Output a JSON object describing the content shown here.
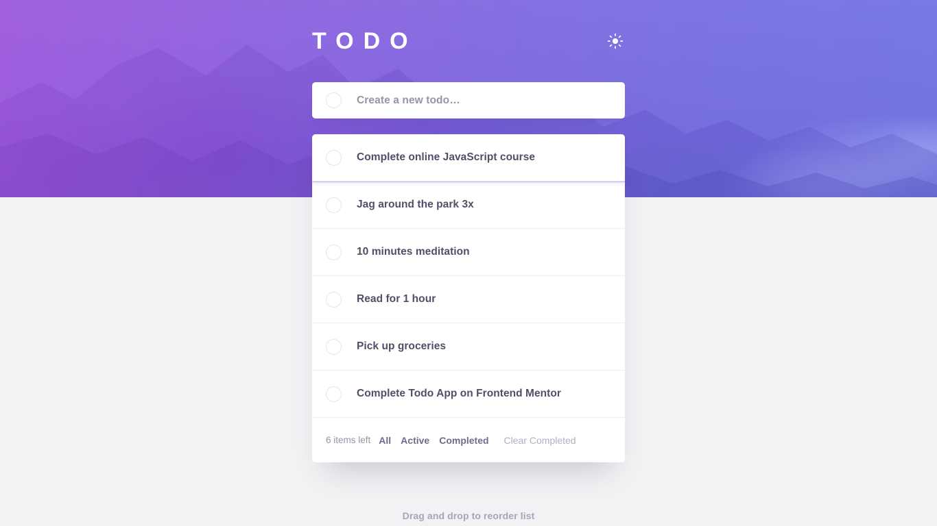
{
  "app": {
    "title": "TODO",
    "theme_toggle_icon": "sun-icon",
    "theme_mode": "light"
  },
  "colors": {
    "gradient_start": "#a747e0",
    "gradient_end": "#5667ee",
    "page_bg": "#f2f2f4",
    "card_bg": "#ffffff",
    "text_primary": "#4d5067",
    "text_muted": "#9495a5",
    "text_faint": "#b0b1c2",
    "divider": "#ededf1",
    "circle_border": "#e3e4f1"
  },
  "new_todo": {
    "placeholder": "Create a new todo…",
    "value": "",
    "checkbox_icon": "circle-icon"
  },
  "todos": [
    {
      "label": "Complete online JavaScript course",
      "completed": false,
      "dragging": true
    },
    {
      "label": "Jag around the park 3x",
      "completed": false,
      "dragging": false
    },
    {
      "label": "10 minutes meditation",
      "completed": false,
      "dragging": false
    },
    {
      "label": "Read for 1 hour",
      "completed": false,
      "dragging": false
    },
    {
      "label": "Pick up groceries",
      "completed": false,
      "dragging": false
    },
    {
      "label": "Complete Todo App on Frontend Mentor",
      "completed": false,
      "dragging": false
    }
  ],
  "footer": {
    "items_left": "6 items left",
    "filters": [
      {
        "label": "All",
        "active": true
      },
      {
        "label": "Active",
        "active": false
      },
      {
        "label": "Completed",
        "active": false
      }
    ],
    "clear_label": "Clear Completed"
  },
  "hint": {
    "text": "Drag and drop to reorder list"
  }
}
